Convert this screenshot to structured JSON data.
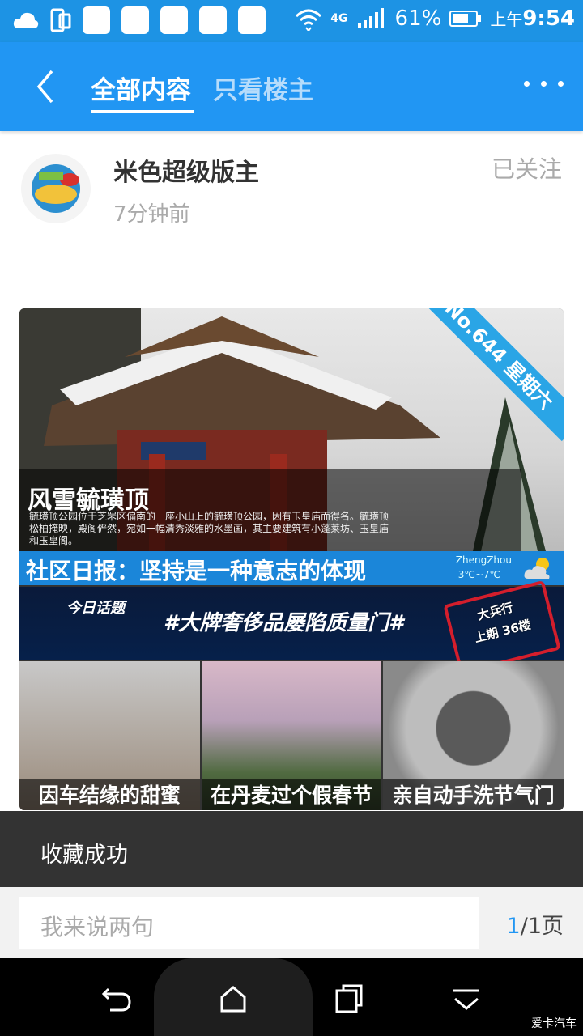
{
  "status_bar": {
    "battery": "61%",
    "network": "4G",
    "ampm": "上午",
    "time": "9:54"
  },
  "header": {
    "tab_all": "全部内容",
    "tab_owner": "只看楼主"
  },
  "post": {
    "author": "米色超级版主",
    "time": "7分钟前",
    "follow_status": "已关注",
    "banner": {
      "ribbon": "No.644 星期六",
      "title": "风雪毓璜顶",
      "desc": "毓璜顶公园位于芝罘区偏南的一座小山上的毓璜顶公园，因有玉皇庙而得名。毓璜顶松柏掩映，殿阁俨然，宛如一幅清秀淡雅的水墨画，其主要建筑有小蓬莱坊、玉皇庙和玉皇阁。"
    },
    "daily": {
      "text": "社区日报：坚持是一种意志的体现",
      "city": "ZhengZhou",
      "temp": "-3℃~7℃"
    },
    "topic": {
      "label": "今日话题",
      "title": "#大牌奢侈品屡陷质量门#",
      "stamp_line1": "大兵行",
      "stamp_line2": "上期 36楼"
    },
    "thumbs": [
      {
        "caption": "因车结缘的甜蜜"
      },
      {
        "caption": "在丹麦过个假春节"
      },
      {
        "caption": "亲自动手洗节气门"
      }
    ]
  },
  "toast": {
    "text": "收藏成功"
  },
  "bottom_bar": {
    "comment_placeholder": "我来说两句",
    "page_current": "1",
    "page_rest": "/1页"
  },
  "watermark": "爱卡汽车",
  "colors": {
    "primary": "#2196f3",
    "status_bar": "#1d93e4",
    "toast_bg": "#333333"
  }
}
